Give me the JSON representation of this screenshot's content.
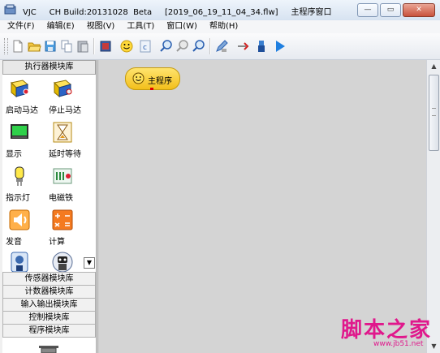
{
  "window": {
    "title": "VJC     CH Build:20131028  Beta     [2019_06_19_11_04_34.flw]     主程序窗口",
    "minimize_label": "—",
    "maximize_label": "▭",
    "close_label": "✕"
  },
  "menu": {
    "items": [
      "文件(F)",
      "编辑(E)",
      "视图(V)",
      "工具(T)",
      "窗口(W)",
      "帮助(H)"
    ]
  },
  "toolbar": {
    "icons": [
      "new-file-icon",
      "open-folder-icon",
      "save-icon",
      "copy-icon",
      "paste-icon",
      "download-icon",
      "smiley-icon",
      "c-code-icon",
      "zoom-in-icon",
      "zoom-out-icon",
      "search-icon",
      "pen-icon",
      "delete-icon",
      "robot-icon",
      "run-icon"
    ]
  },
  "library": {
    "header": "执行器模块库",
    "blocks": [
      {
        "label": "启动马达",
        "icon": "motor-start-icon"
      },
      {
        "label": "停止马达",
        "icon": "motor-stop-icon"
      },
      {
        "label": "显示",
        "icon": "display-icon"
      },
      {
        "label": "延时等待",
        "icon": "hourglass-icon"
      },
      {
        "label": "指示灯",
        "icon": "lamp-icon"
      },
      {
        "label": "电磁铁",
        "icon": "electromagnet-icon"
      },
      {
        "label": "发音",
        "icon": "speaker-icon"
      },
      {
        "label": "计算",
        "icon": "calculator-icon"
      },
      {
        "label": "",
        "icon": "sensor-icon"
      },
      {
        "label": "",
        "icon": "robot-head-icon"
      }
    ],
    "category_buttons": [
      "传感器模块库",
      "计数器模块库",
      "输入输出模块库",
      "控制模块库",
      "程序模块库"
    ],
    "scroll_label": "▼"
  },
  "canvas": {
    "main_program_label": "主程序"
  },
  "scrollbar": {
    "up_label": "▲",
    "down_label": "▼"
  },
  "watermark": {
    "title": "脚本之家",
    "url": "www.jb51.net"
  },
  "colors": {
    "accent": "#f3bf1b",
    "watermark": "#e0188c",
    "canvas_bg": "#d4d4d4"
  }
}
